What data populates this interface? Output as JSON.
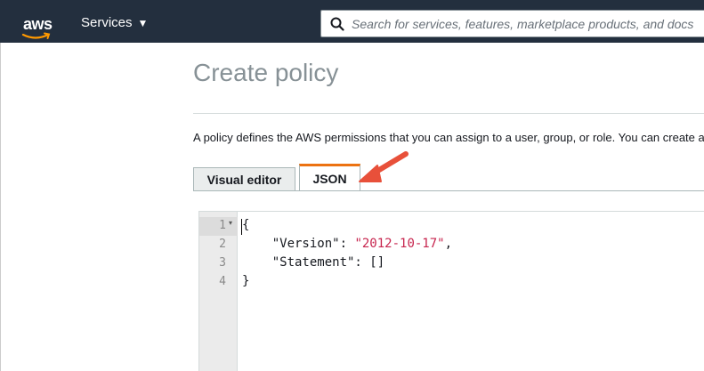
{
  "header": {
    "logo_text": "aws",
    "services_label": "Services",
    "search_placeholder": "Search for services, features, marketplace products, and docs"
  },
  "page": {
    "title": "Create policy",
    "description": "A policy defines the AWS permissions that you can assign to a user, group, or role. You can create and edit a policy in the visual editor and using JSON."
  },
  "tabs": [
    {
      "label": "Visual editor",
      "active": false
    },
    {
      "label": "JSON",
      "active": true
    }
  ],
  "editor": {
    "line_numbers": [
      "1",
      "2",
      "3",
      "4"
    ],
    "lines": {
      "l1": "{",
      "l2_key": "    \"Version\": ",
      "l2_value": "\"2012-10-17\"",
      "l2_end": ",",
      "l3": "    \"Statement\": []",
      "l4": "}"
    }
  },
  "colors": {
    "topbar": "#232f3e",
    "active_tab_accent": "#ec7211",
    "arrow": "#e8503a",
    "string": "#c7254e"
  }
}
